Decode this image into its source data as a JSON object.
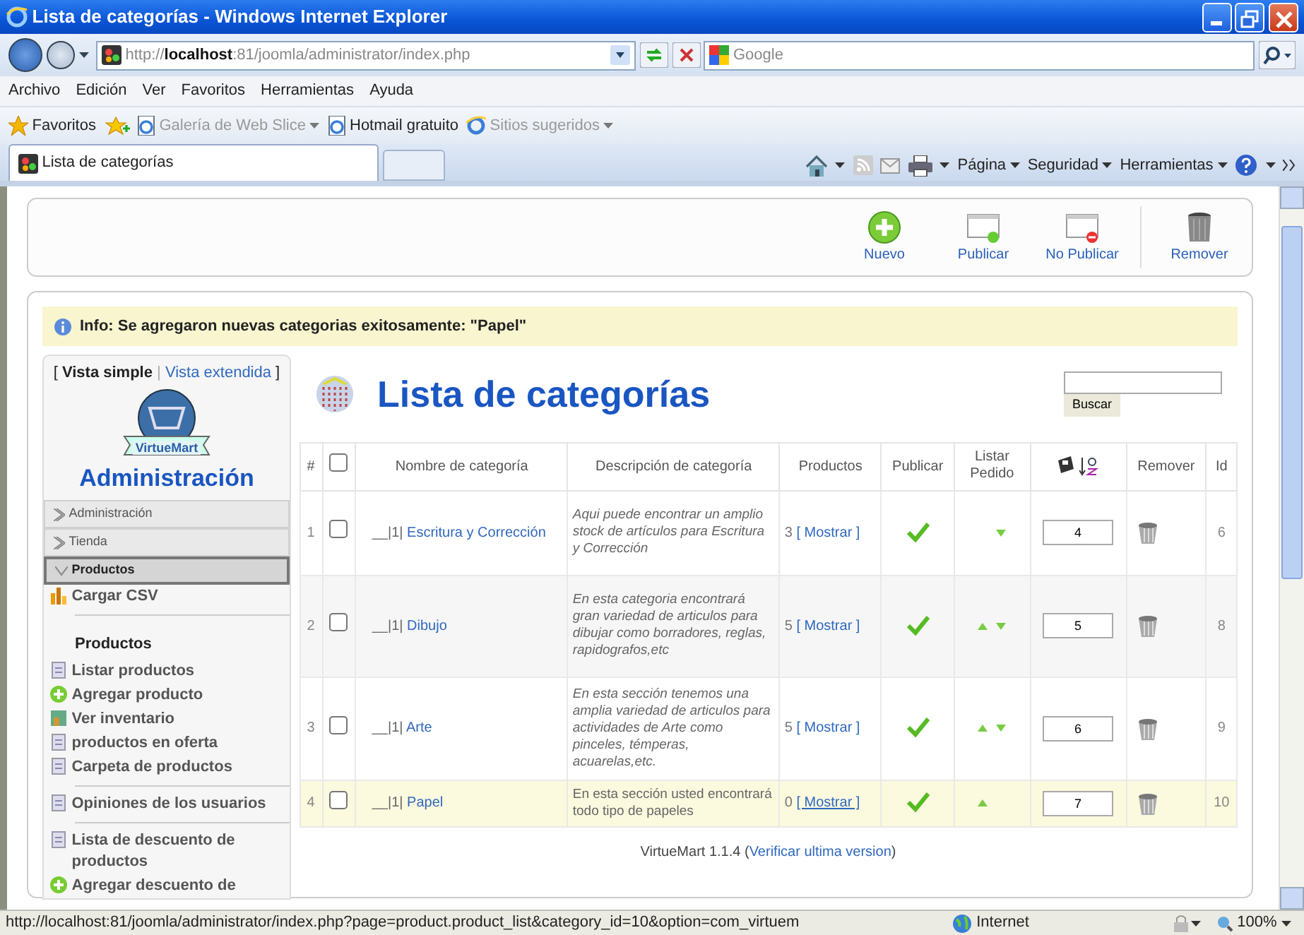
{
  "window": {
    "title": "Lista de categorías - Windows Internet Explorer"
  },
  "address_bar": {
    "url": "http://**localhost**:81/joomla/administrator/index.php",
    "search_placeholder": "Google"
  },
  "menu": [
    "Archivo",
    "Edición",
    "Ver",
    "Favoritos",
    "Herramientas",
    "Ayuda"
  ],
  "favorites_bar": {
    "label": "Favoritos",
    "items": [
      {
        "label": "Galería de Web Slice",
        "dropdown": true,
        "disabled": true
      },
      {
        "label": "Hotmail gratuito",
        "dropdown": false,
        "disabled": false
      },
      {
        "label": "Sitios sugeridos",
        "dropdown": true,
        "disabled": true
      }
    ]
  },
  "tab": {
    "label": "Lista de categorías"
  },
  "command_bar": [
    "Página",
    "Seguridad",
    "Herramientas"
  ],
  "toolbar": [
    {
      "kind": "add",
      "label": "Nuevo"
    },
    {
      "kind": "publish",
      "label": "Publicar"
    },
    {
      "kind": "unpublish",
      "label": "No Publicar"
    },
    {
      "kind": "delete",
      "label": "Remover"
    }
  ],
  "info": {
    "text": "Info: Se agregaron nuevas categorias exitosamente: \"Papel\""
  },
  "sidebar": {
    "open": "[",
    "separator": "|",
    "close": "]",
    "views": [
      {
        "label": "Vista simple",
        "selected": true
      },
      {
        "label": "Vista extendida",
        "selected": false
      }
    ],
    "logo": "VirtueMart",
    "heading": "Administración",
    "sections": [
      {
        "label": "Administración",
        "expanded": false
      },
      {
        "label": "Tienda",
        "expanded": false
      },
      {
        "label": "Productos",
        "expanded": true
      }
    ],
    "items": [
      {
        "kind": "link",
        "label": "Cargar CSV"
      },
      {
        "kind": "divider"
      },
      {
        "kind": "heading",
        "label": "Productos"
      },
      {
        "kind": "link",
        "label": "Listar productos"
      },
      {
        "kind": "link",
        "label": "Agregar producto"
      },
      {
        "kind": "link",
        "label": "Ver inventario"
      },
      {
        "kind": "link",
        "label": "productos en oferta"
      },
      {
        "kind": "link",
        "label": "Carpeta de productos"
      },
      {
        "kind": "divider"
      },
      {
        "kind": "link",
        "label": "Opiniones de los usuarios"
      },
      {
        "kind": "divider"
      },
      {
        "kind": "link",
        "label": "Lista de descuento de productos"
      },
      {
        "kind": "link",
        "label": "Agregar descuento de"
      }
    ]
  },
  "main": {
    "title": "Lista de categorías",
    "search_button": "Buscar",
    "columns": [
      {
        "kind": "text",
        "label": "#"
      },
      {
        "kind": "checkbox",
        "checked": false
      },
      {
        "kind": "text",
        "label": "Nombre de categoría"
      },
      {
        "kind": "text",
        "label": "Descripción de categoría"
      },
      {
        "kind": "text",
        "label": "Productos"
      },
      {
        "kind": "text",
        "label": "Publicar"
      },
      {
        "kind": "text",
        "label": "Listar Pedido"
      },
      {
        "kind": "sort"
      },
      {
        "kind": "text",
        "label": "Remover"
      },
      {
        "kind": "text",
        "label": "Id"
      }
    ],
    "rows": [
      {
        "number": "1",
        "checked": false,
        "prefix": "__|1|",
        "name": "Escritura y Corrección",
        "description": "Aqui puede  encontrar un amplio stock de artículos para Escritura y Corrección",
        "italic": true,
        "count": "3",
        "show": "[ Mostrar ]",
        "published": true,
        "move_up": false,
        "move_down": true,
        "order": "4",
        "id": "6",
        "highlighted": false
      },
      {
        "number": "2",
        "checked": false,
        "prefix": "__|1|",
        "name": "Dibujo",
        "description": "En esta categoria encontrará gran variedad de articulos para dibujar como borradores, reglas, rapidografos,etc",
        "italic": true,
        "count": "5",
        "show": "[ Mostrar ]",
        "published": true,
        "move_up": true,
        "move_down": true,
        "order": "5",
        "id": "8",
        "highlighted": false
      },
      {
        "number": "3",
        "checked": false,
        "prefix": "__|1|",
        "name": "Arte",
        "description": "En esta sección tenemos una amplia variedad de articulos para actividades de Arte como pinceles, témperas, acuarelas,etc.",
        "italic": true,
        "count": "5",
        "show": "[ Mostrar ]",
        "published": true,
        "move_up": true,
        "move_down": true,
        "order": "6",
        "id": "9",
        "highlighted": false
      },
      {
        "number": "4",
        "checked": false,
        "prefix": "__|1|",
        "name": "Papel",
        "description": " En esta sección usted encontrará todo tipo de papeles",
        "italic": false,
        "count": "0",
        "show": "[ Mostrar ]",
        "published": true,
        "move_up": true,
        "move_down": false,
        "order": "7",
        "id": "10",
        "highlighted": true
      }
    ],
    "footer": {
      "version": "VirtueMart 1.1.4",
      "open": "(",
      "link": "Verificar ultima version",
      "close": ")"
    }
  },
  "status_bar": {
    "url": "http://localhost:81/joomla/administrator/index.php?page=product.product_list&category_id=10&option=com_virtuem",
    "zone": "Internet",
    "zoom": "100%"
  }
}
